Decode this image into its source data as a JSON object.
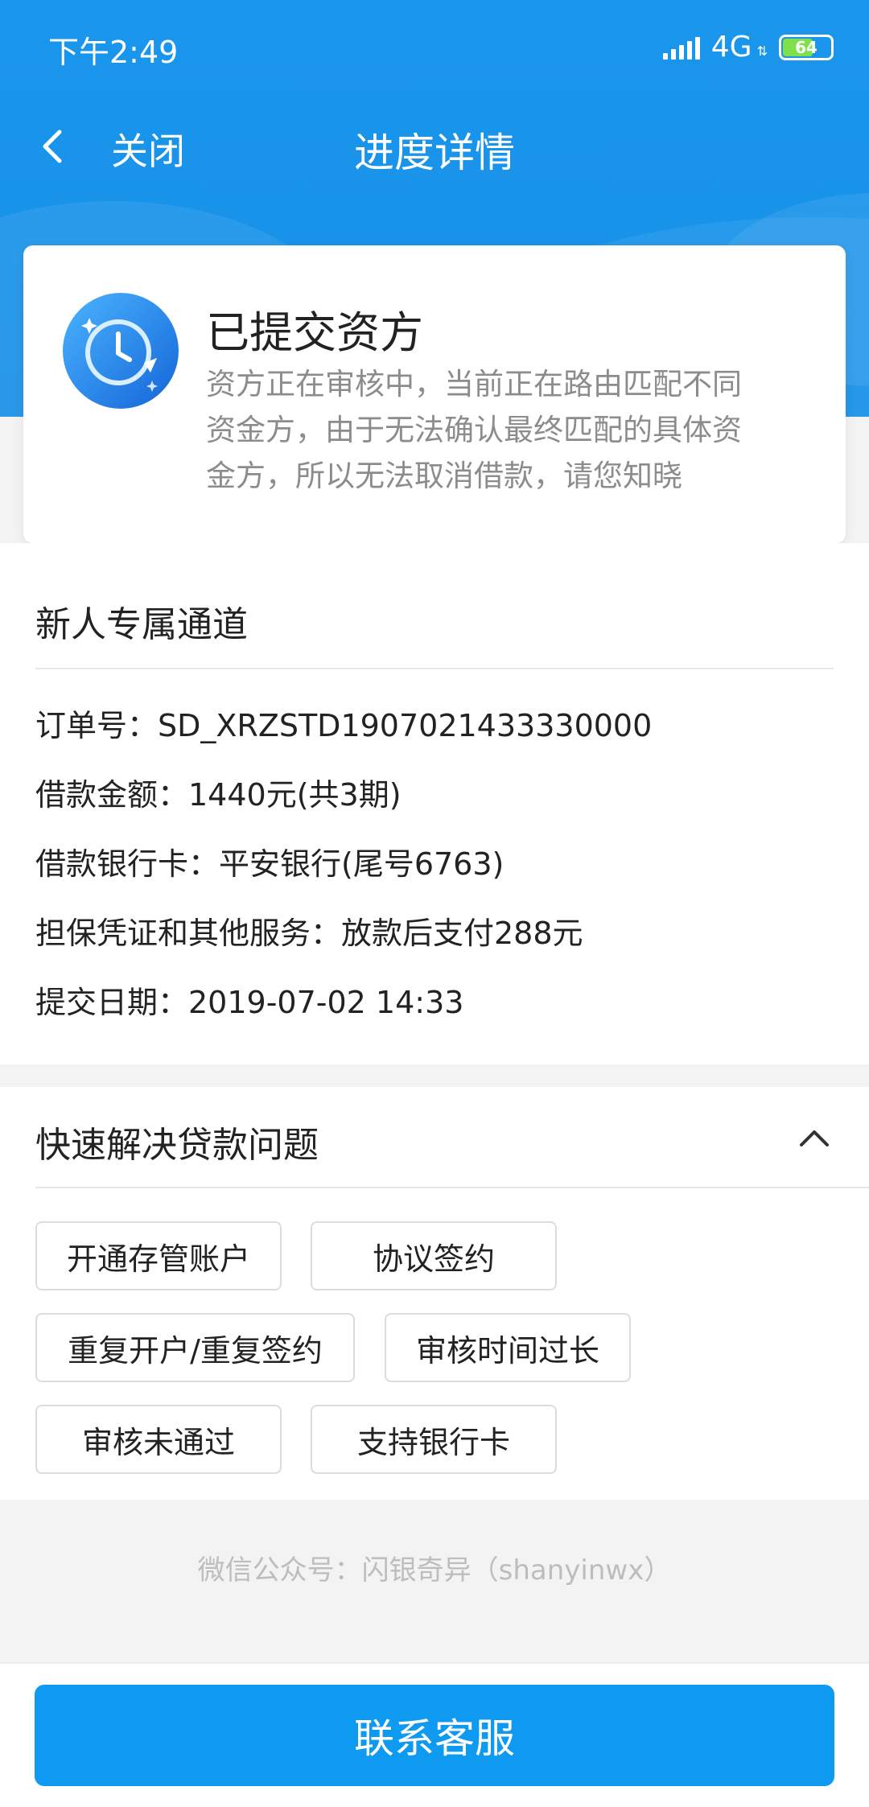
{
  "status_bar": {
    "time": "下午2:49",
    "network": "4G",
    "battery_level": "64",
    "battery_fraction": 0.64
  },
  "nav": {
    "back_icon": "chevron-left-icon",
    "close_label": "关闭",
    "title": "进度详情"
  },
  "status_card": {
    "icon": "clock-icon",
    "title": "已提交资方",
    "description_lines": [
      "资方正在审核中，当前正在路由匹配不同",
      "资金方，由于无法确认最终匹配的具体资",
      "金方，所以无法取消借款，请您知晓"
    ]
  },
  "order": {
    "channel": "新人专属通道",
    "rows": [
      "订单号：SD_XRZSTD1907021433330000",
      "借款金额：1440元(共3期)",
      "借款银行卡：平安银行(尾号6763)",
      "担保凭证和其他服务：放款后支付288元",
      "提交日期：2019-07-02 14:33"
    ]
  },
  "faq": {
    "title": "快速解决贷款问题",
    "toggle_icon": "chevron-up-icon",
    "tags": [
      "开通存管账户",
      "协议签约",
      "重复开户/重复签约",
      "审核时间过长",
      "审核未通过",
      "支持银行卡"
    ]
  },
  "footer": {
    "note": "微信公众号：闪银奇异（shanyinwx）"
  },
  "bottom": {
    "contact_button": "联系客服"
  },
  "colors": {
    "header_blue": "#1790e8",
    "button_blue": "#0e9af0",
    "battery_green": "#7ee04a"
  }
}
